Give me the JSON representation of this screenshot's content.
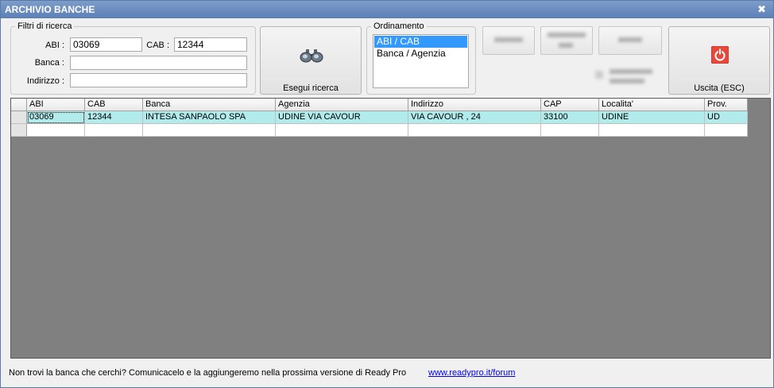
{
  "window": {
    "title": "ARCHIVIO BANCHE",
    "close_icon": "close-icon"
  },
  "filters": {
    "legend": "Filtri di ricerca",
    "abi_label": "ABI :",
    "abi_value": "03069",
    "cab_label": "CAB :",
    "cab_value": "12344",
    "banca_label": "Banca :",
    "banca_value": "",
    "indirizzo_label": "Indirizzo :",
    "indirizzo_value": ""
  },
  "search_button": {
    "label": "Esegui ricerca",
    "icon": "binoculars-icon"
  },
  "ordering": {
    "legend": "Ordinamento",
    "options": [
      "ABI / CAB",
      "Banca / Agenzia"
    ],
    "selected": "ABI / CAB"
  },
  "exit_button": {
    "label": "Uscita (ESC)",
    "icon": "power-icon",
    "icon_color": "#e8473b"
  },
  "grid": {
    "columns": [
      "ABI",
      "CAB",
      "Banca",
      "Agenzia",
      "Indirizzo",
      "CAP",
      "Localita'",
      "Prov."
    ],
    "rows": [
      [
        "03069",
        "12344",
        "INTESA SANPAOLO SPA",
        "UDINE VIA CAVOUR",
        "VIA CAVOUR , 24",
        "33100",
        "UDINE",
        "UD"
      ],
      [
        "",
        "",
        "",
        "",
        "",
        "",
        "",
        ""
      ]
    ],
    "selected_row_color": "#b2ebeb"
  },
  "footer": {
    "text": "Non trovi la banca che cerchi? Comunicacelo e la aggiungeremo nella prossima versione di Ready Pro",
    "link": "www.readypro.it/forum"
  }
}
